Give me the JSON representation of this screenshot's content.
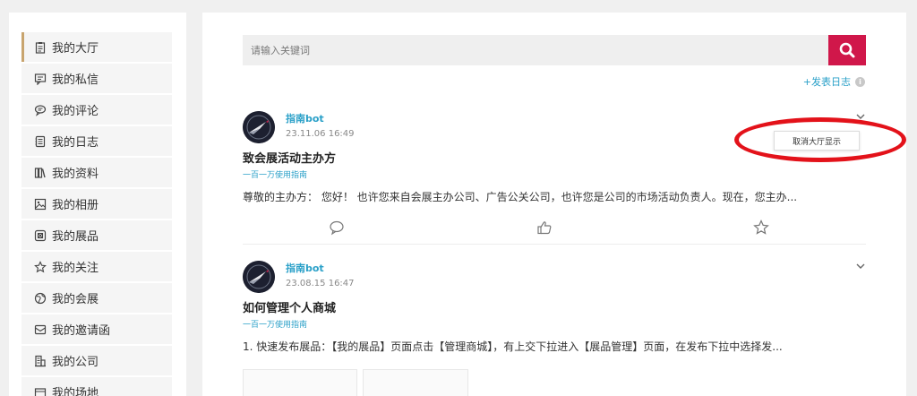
{
  "sidebar": {
    "items": [
      {
        "label": "我的大厅",
        "icon": "clipboard-icon",
        "active": true
      },
      {
        "label": "我的私信",
        "icon": "message-icon"
      },
      {
        "label": "我的评论",
        "icon": "comment-icon"
      },
      {
        "label": "我的日志",
        "icon": "diary-icon"
      },
      {
        "label": "我的资料",
        "icon": "books-icon"
      },
      {
        "label": "我的相册",
        "icon": "image-icon"
      },
      {
        "label": "我的展品",
        "icon": "exhibit-icon"
      },
      {
        "label": "我的关注",
        "icon": "star-icon"
      },
      {
        "label": "我的会展",
        "icon": "globe-icon"
      },
      {
        "label": "我的邀请函",
        "icon": "envelope-icon"
      },
      {
        "label": "我的公司",
        "icon": "building-icon"
      },
      {
        "label": "我的场地",
        "icon": "venue-icon"
      }
    ]
  },
  "search": {
    "placeholder": "请输入关键词",
    "button_icon": "search-icon"
  },
  "post_diary": {
    "label": "+发表日志",
    "info_icon": "info-icon",
    "info_glyph": "i"
  },
  "posts": [
    {
      "author": "指南bot",
      "time": "23.11.06 16:49",
      "title": "致会展活动主办方",
      "guide": "一百一万使用指南",
      "body": "尊敬的主办方： 您好！ 也许您来自会展主办公司、广告公关公司，也许您是公司的市场活动负责人。现在，您主办...",
      "menu_item": "取消大厅显示"
    },
    {
      "author": "指南bot",
      "time": "23.08.15 16:47",
      "title": "如何管理个人商城",
      "guide": "一百一万使用指南",
      "body": "1. 快速发布展品：【我的展品】页面点击【管理商城】，有上交下拉进入【展品管理】页面，在发布下拉中选择发..."
    }
  ],
  "colors": {
    "accent": "#d0174a",
    "link": "#2aa0c8",
    "active_border": "#c8a46e",
    "annotation": "#e3121a"
  }
}
